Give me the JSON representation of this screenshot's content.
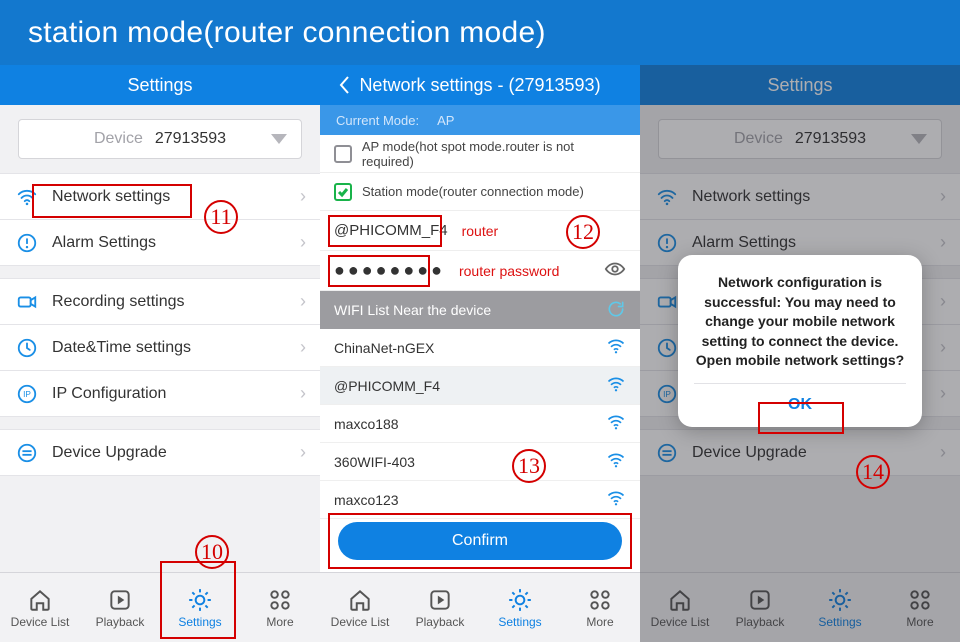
{
  "banner": {
    "title": "station mode(router connection mode)"
  },
  "panel1": {
    "title": "Settings",
    "device_label": "Device",
    "device_id": "27913593",
    "group1": [
      {
        "icon": "wifi",
        "label": "Network settings"
      },
      {
        "icon": "alert",
        "label": "Alarm Settings"
      }
    ],
    "group2": [
      {
        "icon": "rec",
        "label": "Recording settings"
      },
      {
        "icon": "clock",
        "label": "Date&Time settings"
      },
      {
        "icon": "ip",
        "label": "IP Configuration"
      }
    ],
    "group3": [
      {
        "icon": "upgrade",
        "label": "Device Upgrade"
      }
    ]
  },
  "panel2": {
    "title": "Network settings  - (27913593)",
    "current_mode_label": "Current Mode:",
    "current_mode_value": "AP",
    "opt_ap": "AP mode(hot spot mode.router is not required)",
    "opt_station": "Station mode(router connection mode)",
    "ssid_value": "@PHICOMM_F4",
    "ssid_hint": "router",
    "pwd_value_masked": "●●●●●●●●",
    "pwd_hint": "router password",
    "wifi_header": "WIFI List Near the device",
    "wifi_list": [
      {
        "ssid": "ChinaNet-nGEX",
        "selected": false
      },
      {
        "ssid": "@PHICOMM_F4",
        "selected": true
      },
      {
        "ssid": "maxco188",
        "selected": false
      },
      {
        "ssid": "360WIFI-403",
        "selected": false
      },
      {
        "ssid": "maxco123",
        "selected": false
      }
    ],
    "confirm_label": "Confirm"
  },
  "panel3": {
    "title": "Settings",
    "device_label": "Device",
    "device_id": "27913593",
    "alert_msg": "Network configuration is successful: You may need to change your mobile network setting to connect the device. Open mobile network settings?",
    "alert_ok": "OK"
  },
  "tabs": {
    "items": [
      "Device List",
      "Playback",
      "Settings",
      "More"
    ],
    "active_index": 2
  },
  "annotations": {
    "n10": "10",
    "n11": "11",
    "n12": "12",
    "n13": "13",
    "n14": "14"
  }
}
